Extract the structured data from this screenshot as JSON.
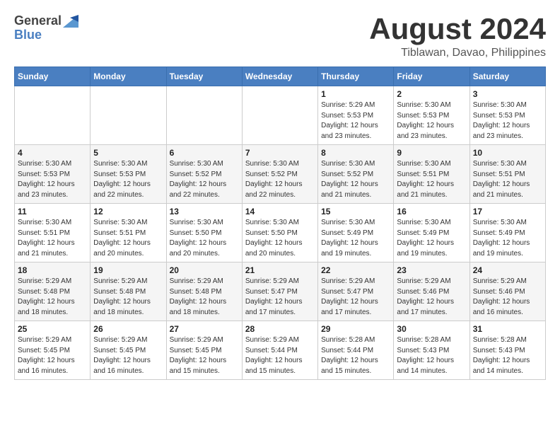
{
  "header": {
    "logo_general": "General",
    "logo_blue": "Blue",
    "month_year": "August 2024",
    "location": "Tiblawan, Davao, Philippines"
  },
  "weekdays": [
    "Sunday",
    "Monday",
    "Tuesday",
    "Wednesday",
    "Thursday",
    "Friday",
    "Saturday"
  ],
  "weeks": [
    [
      {
        "day": "",
        "info": ""
      },
      {
        "day": "",
        "info": ""
      },
      {
        "day": "",
        "info": ""
      },
      {
        "day": "",
        "info": ""
      },
      {
        "day": "1",
        "info": "Sunrise: 5:29 AM\nSunset: 5:53 PM\nDaylight: 12 hours\nand 23 minutes."
      },
      {
        "day": "2",
        "info": "Sunrise: 5:30 AM\nSunset: 5:53 PM\nDaylight: 12 hours\nand 23 minutes."
      },
      {
        "day": "3",
        "info": "Sunrise: 5:30 AM\nSunset: 5:53 PM\nDaylight: 12 hours\nand 23 minutes."
      }
    ],
    [
      {
        "day": "4",
        "info": "Sunrise: 5:30 AM\nSunset: 5:53 PM\nDaylight: 12 hours\nand 23 minutes."
      },
      {
        "day": "5",
        "info": "Sunrise: 5:30 AM\nSunset: 5:53 PM\nDaylight: 12 hours\nand 22 minutes."
      },
      {
        "day": "6",
        "info": "Sunrise: 5:30 AM\nSunset: 5:52 PM\nDaylight: 12 hours\nand 22 minutes."
      },
      {
        "day": "7",
        "info": "Sunrise: 5:30 AM\nSunset: 5:52 PM\nDaylight: 12 hours\nand 22 minutes."
      },
      {
        "day": "8",
        "info": "Sunrise: 5:30 AM\nSunset: 5:52 PM\nDaylight: 12 hours\nand 21 minutes."
      },
      {
        "day": "9",
        "info": "Sunrise: 5:30 AM\nSunset: 5:51 PM\nDaylight: 12 hours\nand 21 minutes."
      },
      {
        "day": "10",
        "info": "Sunrise: 5:30 AM\nSunset: 5:51 PM\nDaylight: 12 hours\nand 21 minutes."
      }
    ],
    [
      {
        "day": "11",
        "info": "Sunrise: 5:30 AM\nSunset: 5:51 PM\nDaylight: 12 hours\nand 21 minutes."
      },
      {
        "day": "12",
        "info": "Sunrise: 5:30 AM\nSunset: 5:51 PM\nDaylight: 12 hours\nand 20 minutes."
      },
      {
        "day": "13",
        "info": "Sunrise: 5:30 AM\nSunset: 5:50 PM\nDaylight: 12 hours\nand 20 minutes."
      },
      {
        "day": "14",
        "info": "Sunrise: 5:30 AM\nSunset: 5:50 PM\nDaylight: 12 hours\nand 20 minutes."
      },
      {
        "day": "15",
        "info": "Sunrise: 5:30 AM\nSunset: 5:49 PM\nDaylight: 12 hours\nand 19 minutes."
      },
      {
        "day": "16",
        "info": "Sunrise: 5:30 AM\nSunset: 5:49 PM\nDaylight: 12 hours\nand 19 minutes."
      },
      {
        "day": "17",
        "info": "Sunrise: 5:30 AM\nSunset: 5:49 PM\nDaylight: 12 hours\nand 19 minutes."
      }
    ],
    [
      {
        "day": "18",
        "info": "Sunrise: 5:29 AM\nSunset: 5:48 PM\nDaylight: 12 hours\nand 18 minutes."
      },
      {
        "day": "19",
        "info": "Sunrise: 5:29 AM\nSunset: 5:48 PM\nDaylight: 12 hours\nand 18 minutes."
      },
      {
        "day": "20",
        "info": "Sunrise: 5:29 AM\nSunset: 5:48 PM\nDaylight: 12 hours\nand 18 minutes."
      },
      {
        "day": "21",
        "info": "Sunrise: 5:29 AM\nSunset: 5:47 PM\nDaylight: 12 hours\nand 17 minutes."
      },
      {
        "day": "22",
        "info": "Sunrise: 5:29 AM\nSunset: 5:47 PM\nDaylight: 12 hours\nand 17 minutes."
      },
      {
        "day": "23",
        "info": "Sunrise: 5:29 AM\nSunset: 5:46 PM\nDaylight: 12 hours\nand 17 minutes."
      },
      {
        "day": "24",
        "info": "Sunrise: 5:29 AM\nSunset: 5:46 PM\nDaylight: 12 hours\nand 16 minutes."
      }
    ],
    [
      {
        "day": "25",
        "info": "Sunrise: 5:29 AM\nSunset: 5:45 PM\nDaylight: 12 hours\nand 16 minutes."
      },
      {
        "day": "26",
        "info": "Sunrise: 5:29 AM\nSunset: 5:45 PM\nDaylight: 12 hours\nand 16 minutes."
      },
      {
        "day": "27",
        "info": "Sunrise: 5:29 AM\nSunset: 5:45 PM\nDaylight: 12 hours\nand 15 minutes."
      },
      {
        "day": "28",
        "info": "Sunrise: 5:29 AM\nSunset: 5:44 PM\nDaylight: 12 hours\nand 15 minutes."
      },
      {
        "day": "29",
        "info": "Sunrise: 5:28 AM\nSunset: 5:44 PM\nDaylight: 12 hours\nand 15 minutes."
      },
      {
        "day": "30",
        "info": "Sunrise: 5:28 AM\nSunset: 5:43 PM\nDaylight: 12 hours\nand 14 minutes."
      },
      {
        "day": "31",
        "info": "Sunrise: 5:28 AM\nSunset: 5:43 PM\nDaylight: 12 hours\nand 14 minutes."
      }
    ]
  ]
}
